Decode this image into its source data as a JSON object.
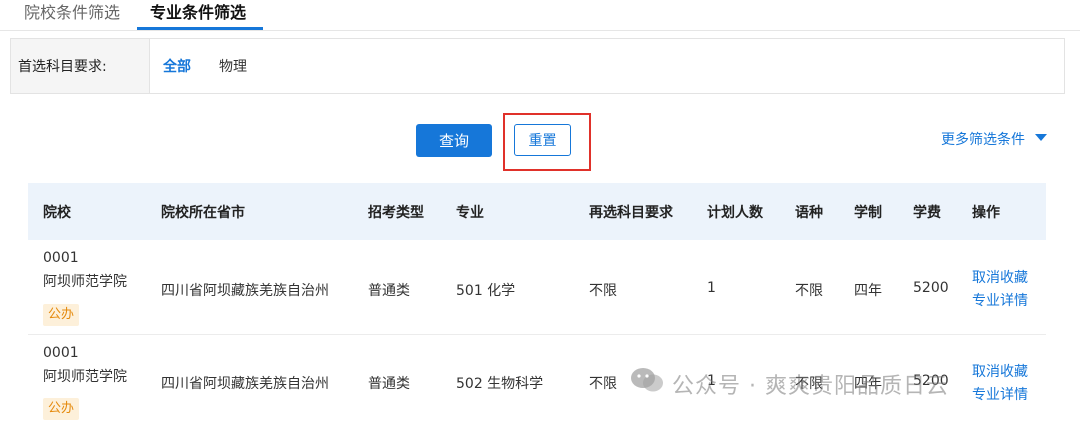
{
  "tabs": [
    {
      "label": "院校条件筛选"
    },
    {
      "label": "专业条件筛选"
    }
  ],
  "filter": {
    "label": "首选科目要求:",
    "options": [
      "全部",
      "物理"
    ]
  },
  "buttons": {
    "query": "查询",
    "reset": "重置",
    "more": "更多筛选条件"
  },
  "table": {
    "headers": [
      "院校",
      "院校所在省市",
      "招考类型",
      "专业",
      "再选科目要求",
      "计划人数",
      "语种",
      "学制",
      "学费",
      "操作"
    ],
    "rows": [
      {
        "code": "0001",
        "school": "阿坝师范学院",
        "badge": "公办",
        "location": "四川省阿坝藏族羌族自治州",
        "type": "普通类",
        "major": "501 化学",
        "requirement": "不限",
        "plan": "1",
        "language": "不限",
        "duration": "四年",
        "fee": "5200",
        "action1": "取消收藏",
        "action2": "专业详情"
      },
      {
        "code": "0001",
        "school": "阿坝师范学院",
        "badge": "公办",
        "location": "四川省阿坝藏族羌族自治州",
        "type": "普通类",
        "major": "502 生物科学",
        "requirement": "不限",
        "plan": "1",
        "language": "不限",
        "duration": "四年",
        "fee": "5200",
        "action1": "取消收藏",
        "action2": "专业详情"
      }
    ]
  },
  "watermark": "公众号 · 爽爽贵阳品质日云",
  "colors": {
    "accent": "#1677d9",
    "highlight_border": "#e0312a",
    "badge_text": "#e58a0d",
    "badge_bg": "#fdf0da",
    "table_header_bg": "#ecf3fb"
  }
}
